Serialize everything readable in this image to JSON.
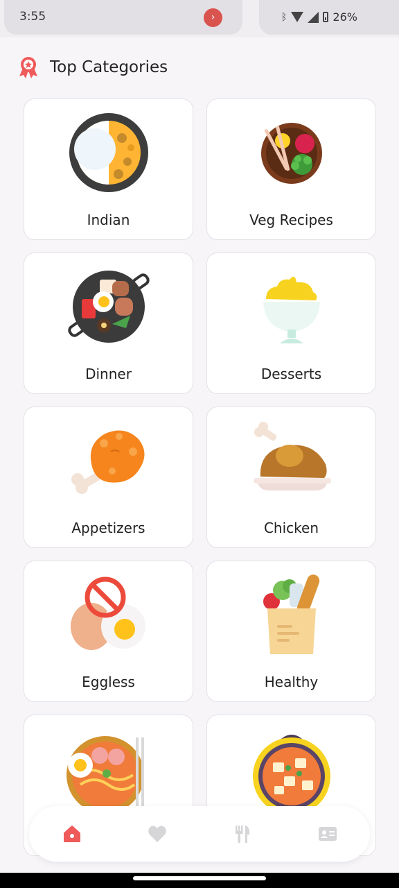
{
  "status_bar": {
    "time": "3:55",
    "battery": "26%"
  },
  "header": {
    "title": "Top Categories"
  },
  "categories": [
    {
      "label": "Indian"
    },
    {
      "label": "Veg Recipes"
    },
    {
      "label": "Dinner"
    },
    {
      "label": "Desserts"
    },
    {
      "label": "Appetizers"
    },
    {
      "label": "Chicken"
    },
    {
      "label": "Eggless"
    },
    {
      "label": "Healthy"
    },
    {
      "label": ""
    },
    {
      "label": ""
    }
  ],
  "nav": {
    "items": [
      {
        "icon": "home-icon",
        "active": true
      },
      {
        "icon": "heart-icon",
        "active": false
      },
      {
        "icon": "fork-knife-icon",
        "active": false
      },
      {
        "icon": "profile-card-icon",
        "active": false
      }
    ]
  },
  "colors": {
    "accent": "#ef5a5a",
    "inactive": "#d6d6d8"
  }
}
